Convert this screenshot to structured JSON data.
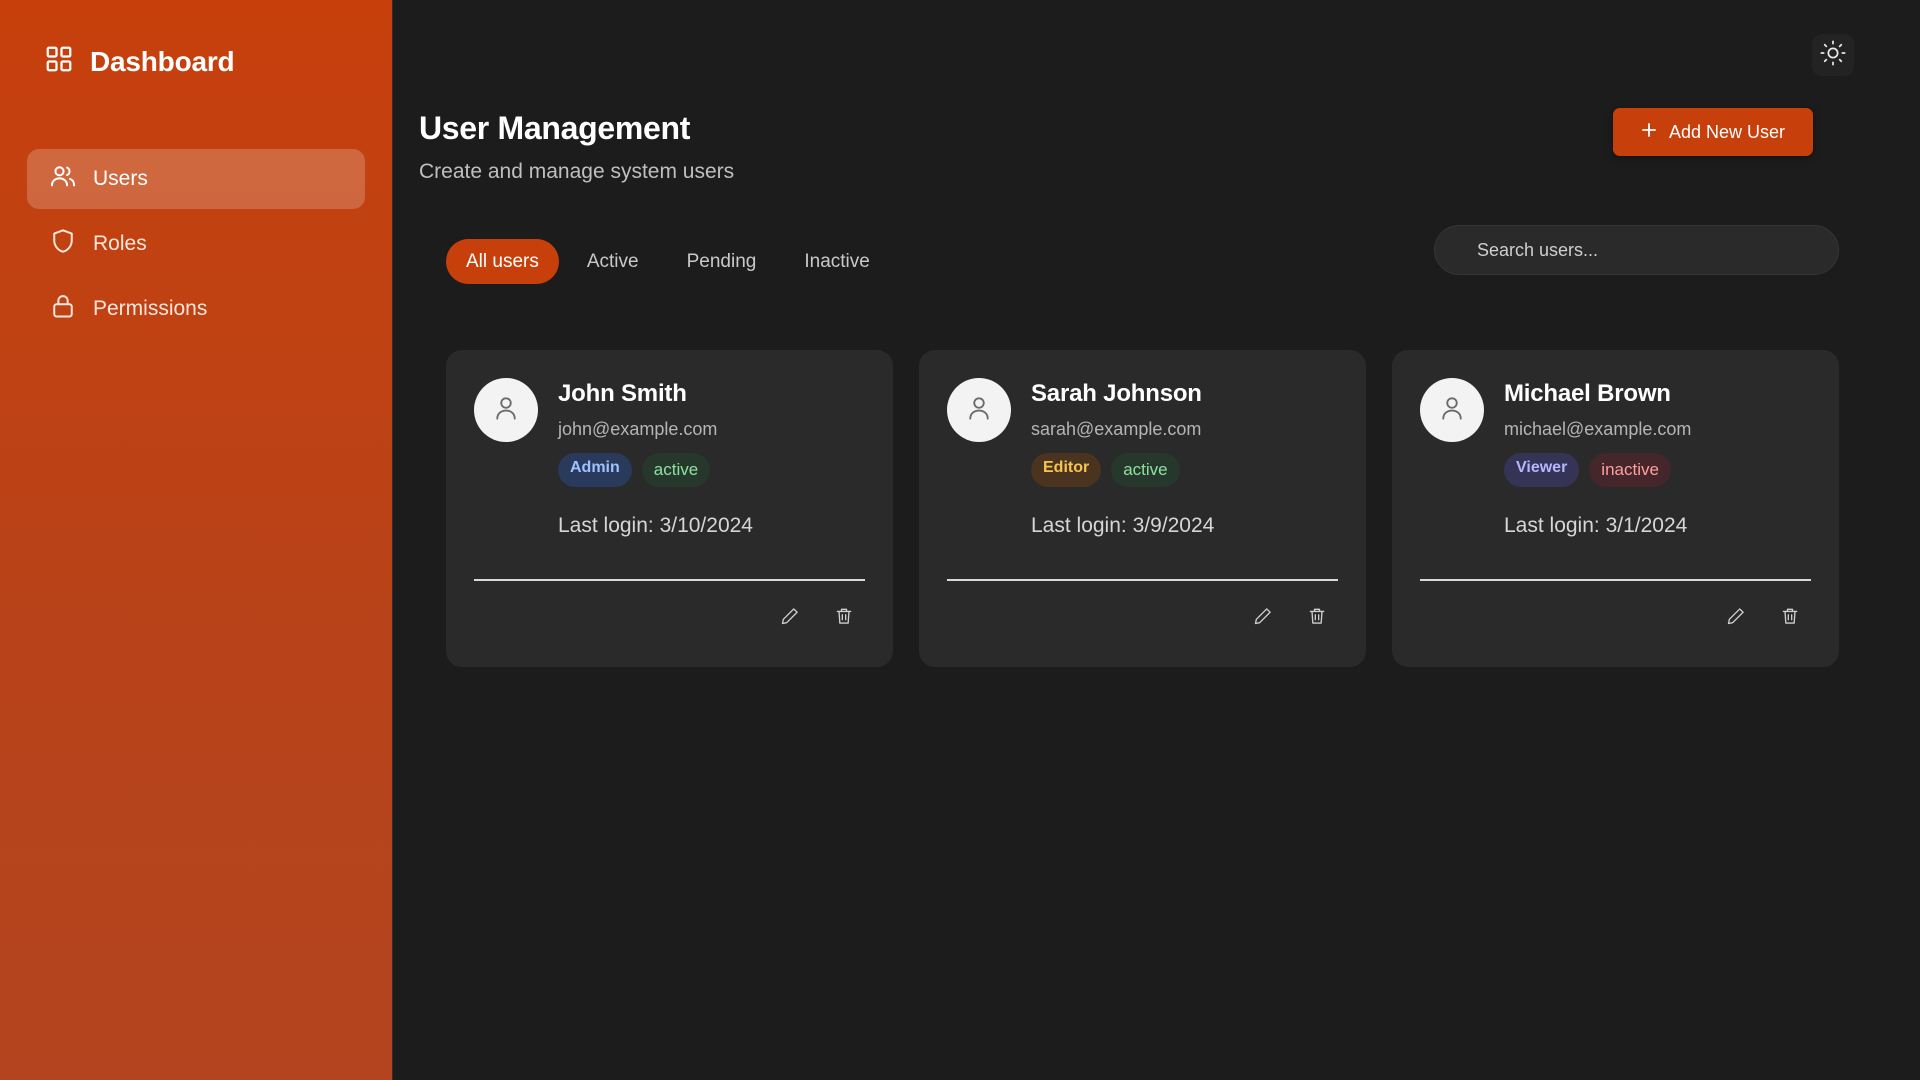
{
  "sidebar": {
    "brand": "Dashboard",
    "items": [
      {
        "label": "Users",
        "icon": "users-icon",
        "active": true
      },
      {
        "label": "Roles",
        "icon": "shield-icon",
        "active": false
      },
      {
        "label": "Permissions",
        "icon": "lock-icon",
        "active": false
      }
    ]
  },
  "header": {
    "title": "User Management",
    "subtitle": "Create and manage system users",
    "add_button": "Add New User",
    "theme_toggle_icon": "sun-icon"
  },
  "tabs": [
    {
      "label": "All users",
      "active": true
    },
    {
      "label": "Active",
      "active": false
    },
    {
      "label": "Pending",
      "active": false
    },
    {
      "label": "Inactive",
      "active": false
    }
  ],
  "search": {
    "placeholder": "Search users..."
  },
  "users": [
    {
      "name": "John Smith",
      "email": "john@example.com",
      "role": "Admin",
      "status": "active",
      "last_login": "Last login: 3/10/2024"
    },
    {
      "name": "Sarah Johnson",
      "email": "sarah@example.com",
      "role": "Editor",
      "status": "active",
      "last_login": "Last login: 3/9/2024"
    },
    {
      "name": "Michael Brown",
      "email": "michael@example.com",
      "role": "Viewer",
      "status": "inactive",
      "last_login": "Last login: 3/1/2024"
    }
  ],
  "colors": {
    "accent": "#c7400c",
    "sidebar_bg": "#c0420f",
    "main_bg": "#1c1c1c",
    "card_bg": "#2a2a2a",
    "admin_badge_bg": "#2a3a5c",
    "admin_badge_text": "#9ec2ff",
    "editor_badge_bg": "#4a3420",
    "editor_badge_text": "#f5c451",
    "viewer_badge_bg": "#353456",
    "viewer_badge_text": "#b4b6ff",
    "active_badge_bg": "#26382c",
    "active_badge_text": "#8fe0a0",
    "inactive_badge_bg": "#45262a",
    "inactive_badge_text": "#ff9f9f"
  }
}
